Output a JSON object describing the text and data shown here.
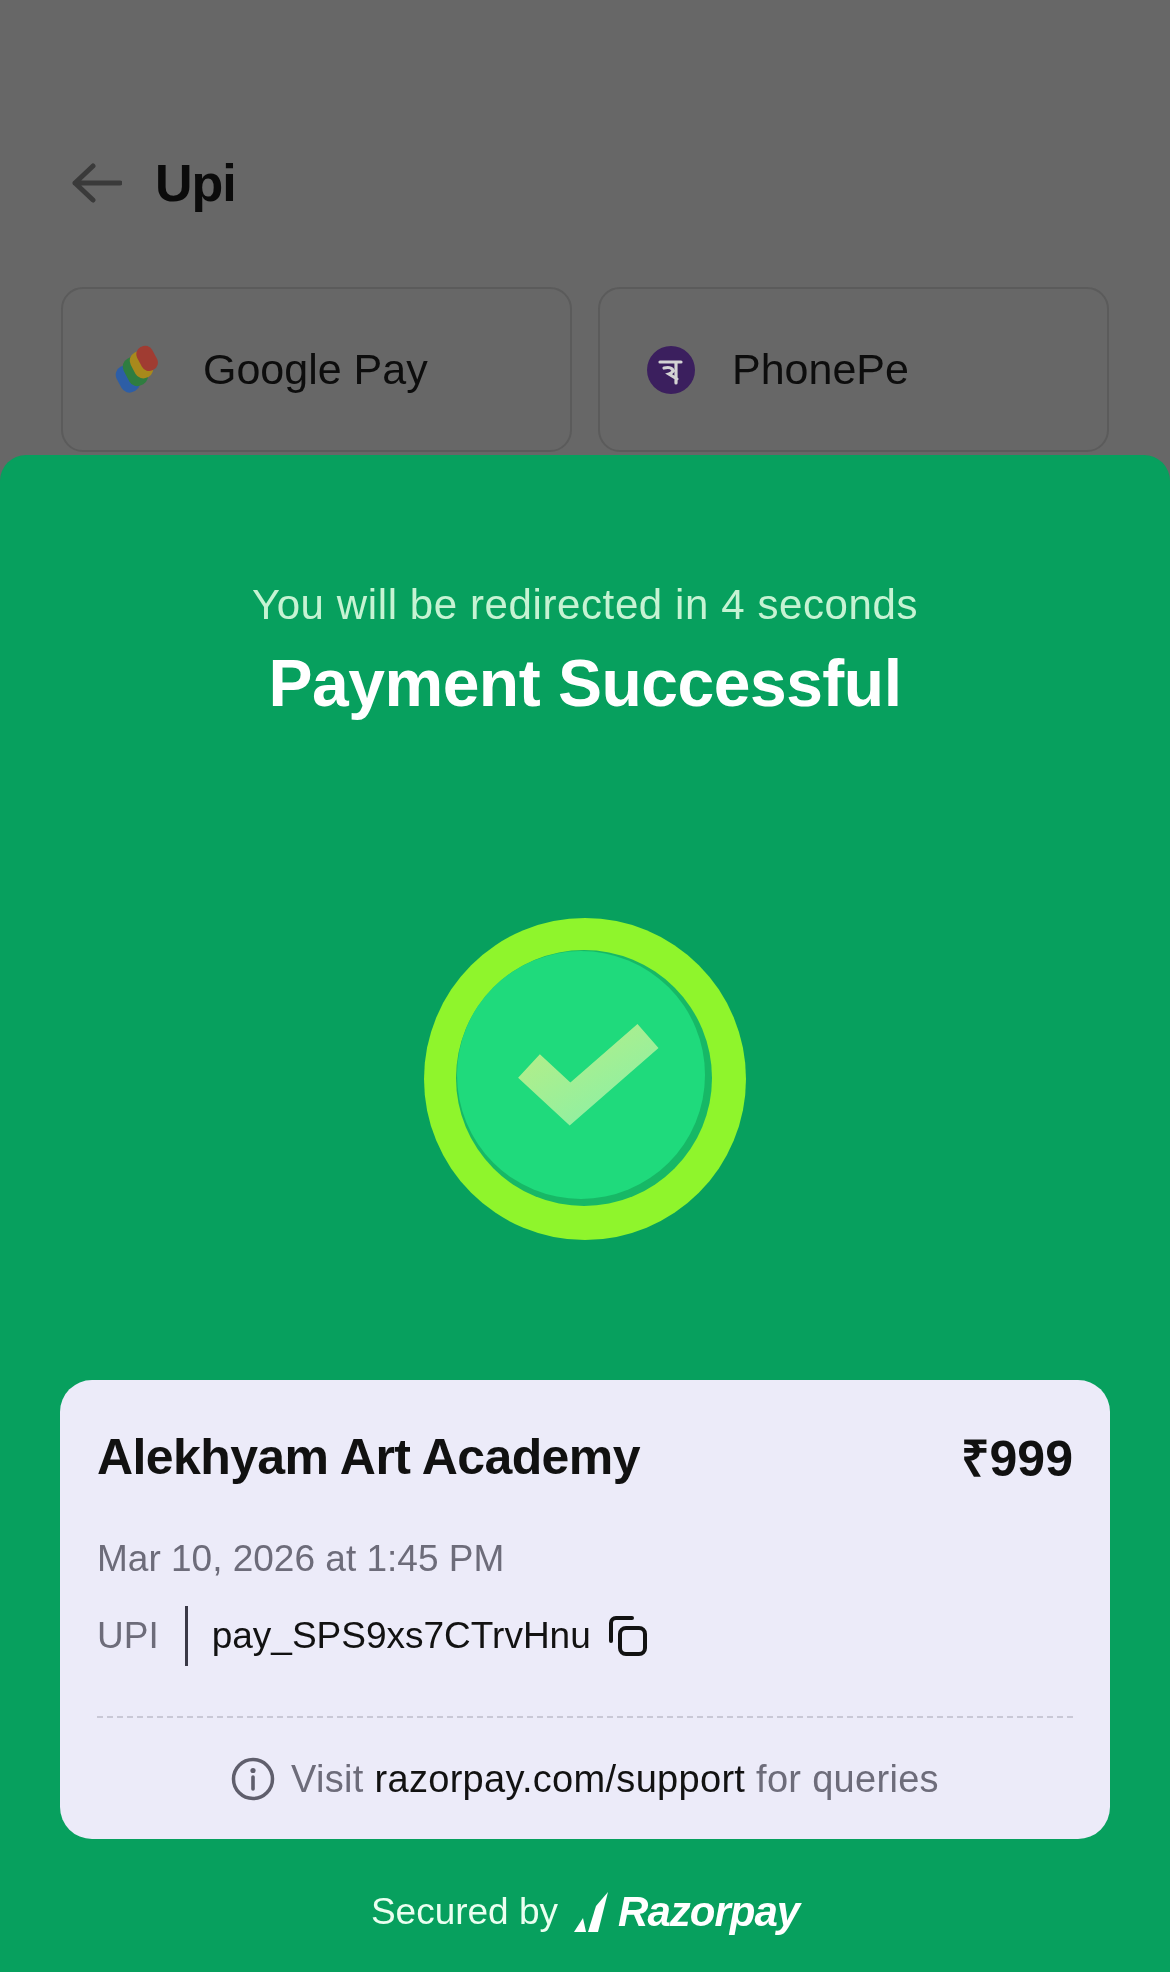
{
  "header": {
    "title": "Upi"
  },
  "apps": [
    {
      "name": "Google Pay",
      "kind": "gpay"
    },
    {
      "name": "PhonePe",
      "kind": "phonepe"
    }
  ],
  "sheet": {
    "redirect_text": "You will be redirected in 4 seconds",
    "title": "Payment Successful"
  },
  "receipt": {
    "merchant": "Alekhyam Art Academy",
    "amount": "₹999",
    "datetime": "Mar 10, 2026 at 1:45 PM",
    "method": "UPI",
    "payment_id": "pay_SPS9xs7CTrvHnu",
    "support_before": "Visit",
    "support_link": "razorpay.com/support",
    "support_after": "for queries"
  },
  "footer": {
    "secured_by": "Secured by",
    "brand": "Razorpay"
  }
}
